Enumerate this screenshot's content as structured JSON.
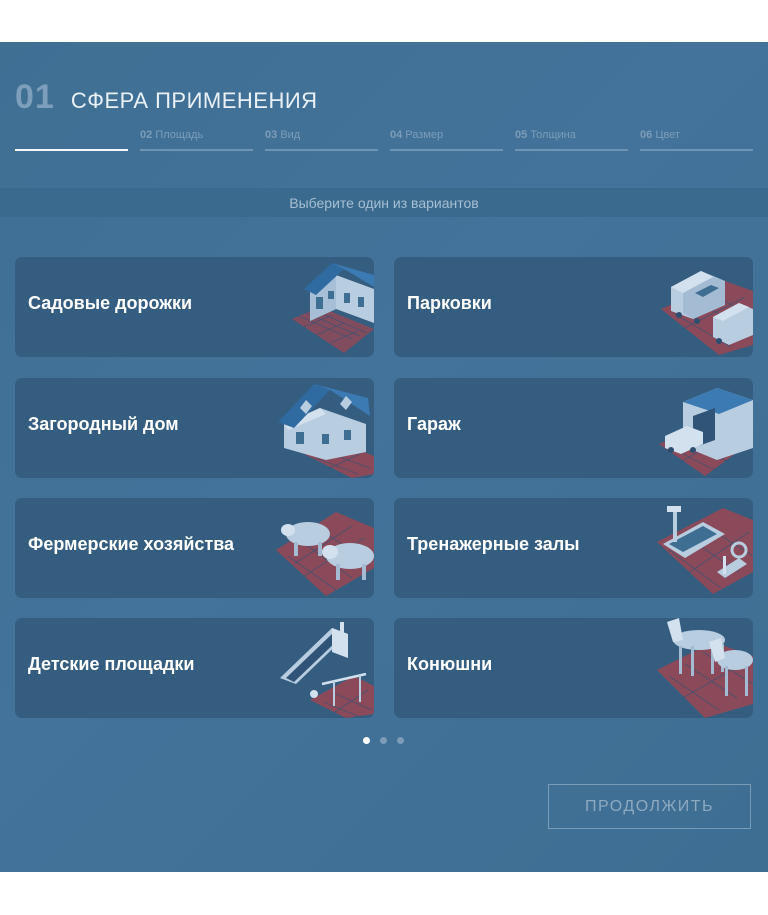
{
  "header": {
    "step_number": "01",
    "step_title": "СФЕРА ПРИМЕНЕНИЯ"
  },
  "steps": [
    {
      "num": "",
      "label": ""
    },
    {
      "num": "02",
      "label": "Площадь"
    },
    {
      "num": "03",
      "label": "Вид"
    },
    {
      "num": "04",
      "label": "Размер"
    },
    {
      "num": "05",
      "label": "Толщина"
    },
    {
      "num": "06",
      "label": "Цвет"
    }
  ],
  "hint": "Выберите один из вариантов",
  "options": [
    {
      "label": "Садовые дорожки",
      "icon": "garden-house-icon"
    },
    {
      "label": "Парковки",
      "icon": "parking-cars-icon"
    },
    {
      "label": "Загородный дом",
      "icon": "country-house-icon"
    },
    {
      "label": "Гараж",
      "icon": "garage-icon"
    },
    {
      "label": "Фермерские хозяйства",
      "icon": "farm-pigs-icon"
    },
    {
      "label": "Тренажерные залы",
      "icon": "gym-equipment-icon"
    },
    {
      "label": "Детские площадки",
      "icon": "playground-slide-icon"
    },
    {
      "label": "Конюшни",
      "icon": "horses-icon"
    }
  ],
  "pagination": {
    "pages": 3,
    "current": 1
  },
  "continue_label": "ПРОДОЛЖИТЬ",
  "colors": {
    "background": "#43739a",
    "card": "#345d80",
    "tile": "#8a4a5a",
    "icon_light": "#b9cde0",
    "icon_dark": "#2f6aa0"
  }
}
